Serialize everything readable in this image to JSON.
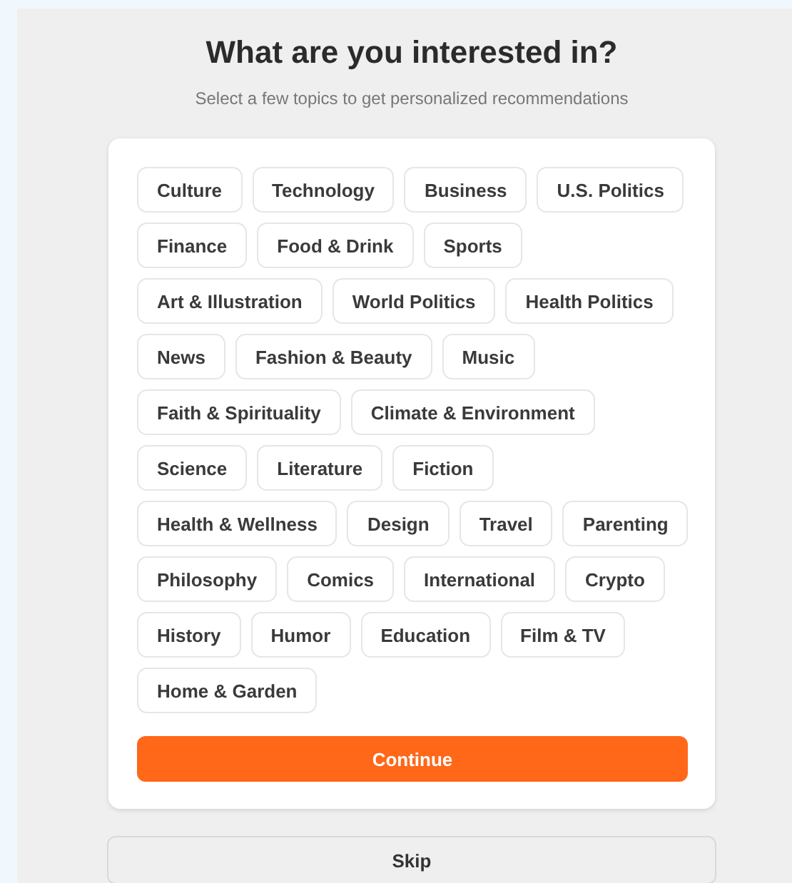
{
  "heading": "What are you interested in?",
  "subheading": "Select a few topics to get personalized recommendations",
  "topic_rows": [
    [
      {
        "label": "Culture",
        "selected": false
      },
      {
        "label": "Technology",
        "selected": false
      },
      {
        "label": "Business",
        "selected": false
      },
      {
        "label": "U.S. Politics",
        "selected": false
      }
    ],
    [
      {
        "label": "Finance",
        "selected": false
      },
      {
        "label": "Food & Drink",
        "selected": false
      },
      {
        "label": "Sports",
        "selected": false
      }
    ],
    [
      {
        "label": "Art & Illustration",
        "selected": false
      },
      {
        "label": "World Politics",
        "selected": false
      },
      {
        "label": "Health Politics",
        "selected": false
      }
    ],
    [
      {
        "label": "News",
        "selected": false
      },
      {
        "label": "Fashion & Beauty",
        "selected": false
      },
      {
        "label": "Music",
        "selected": false
      }
    ],
    [
      {
        "label": "Faith & Spirituality",
        "selected": false
      },
      {
        "label": "Climate & Environment",
        "selected": false
      }
    ],
    [
      {
        "label": "Science",
        "selected": false
      },
      {
        "label": "Literature",
        "selected": false
      },
      {
        "label": "Fiction",
        "selected": false
      }
    ],
    [
      {
        "label": "Health & Wellness",
        "selected": false
      },
      {
        "label": "Design",
        "selected": false
      },
      {
        "label": "Travel",
        "selected": false
      },
      {
        "label": "Parenting",
        "selected": false
      }
    ],
    [
      {
        "label": "Philosophy",
        "selected": false
      },
      {
        "label": "Comics",
        "selected": false
      },
      {
        "label": "International",
        "selected": false
      },
      {
        "label": "Crypto",
        "selected": false
      }
    ],
    [
      {
        "label": "History",
        "selected": false
      },
      {
        "label": "Humor",
        "selected": false
      },
      {
        "label": "Education",
        "selected": false
      },
      {
        "label": "Film & TV",
        "selected": false
      }
    ],
    [
      {
        "label": "Home & Garden",
        "selected": false
      }
    ]
  ],
  "continue_button": "Continue",
  "skip_button": "Skip"
}
